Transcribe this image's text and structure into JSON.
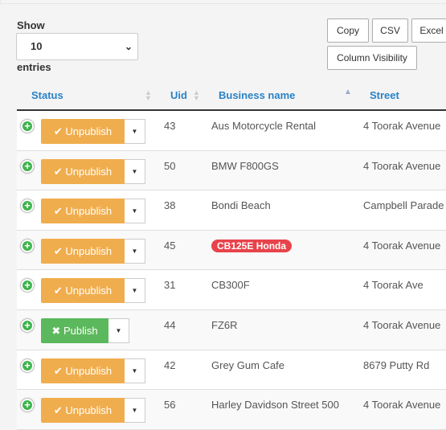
{
  "length": {
    "show_label": "Show",
    "value": "10",
    "entries_label": "entries"
  },
  "export_buttons": [
    "Copy",
    "CSV",
    "Excel",
    "Column Visibility"
  ],
  "columns": [
    "Status",
    "Uid",
    "Business name",
    "Street"
  ],
  "rows": [
    {
      "status": "Unpublish",
      "uid": "43",
      "name": "Aus Motorcycle Rental",
      "street": "4 Toorak Avenue"
    },
    {
      "status": "Unpublish",
      "uid": "50",
      "name": "BMW F800GS",
      "street": "4 Toorak Avenue"
    },
    {
      "status": "Unpublish",
      "uid": "38",
      "name": "Bondi Beach",
      "street": "Campbell Parade"
    },
    {
      "status": "Unpublish",
      "uid": "45",
      "name": "CB125E Honda",
      "street": "4 Toorak Avenue",
      "highlighted": true
    },
    {
      "status": "Unpublish",
      "uid": "31",
      "name": "CB300F",
      "street": "4 Toorak Ave"
    },
    {
      "status": "Publish",
      "uid": "44",
      "name": "FZ6R",
      "street": "4 Toorak Avenue"
    },
    {
      "status": "Unpublish",
      "uid": "42",
      "name": "Grey Gum Cafe",
      "street": "8679 Putty Rd"
    },
    {
      "status": "Unpublish",
      "uid": "56",
      "name": "Harley Davidson Street 500",
      "street": "4 Toorak Avenue"
    }
  ],
  "icons": {
    "expand": "plus-circle-icon",
    "unpublish": "check-icon",
    "publish": "times-icon",
    "dropdown": "caret-down-icon"
  },
  "colors": {
    "unpublish": "#f0ad4e",
    "publish": "#5cb85c",
    "header": "#2a82c6",
    "badge": "#e8434b"
  }
}
